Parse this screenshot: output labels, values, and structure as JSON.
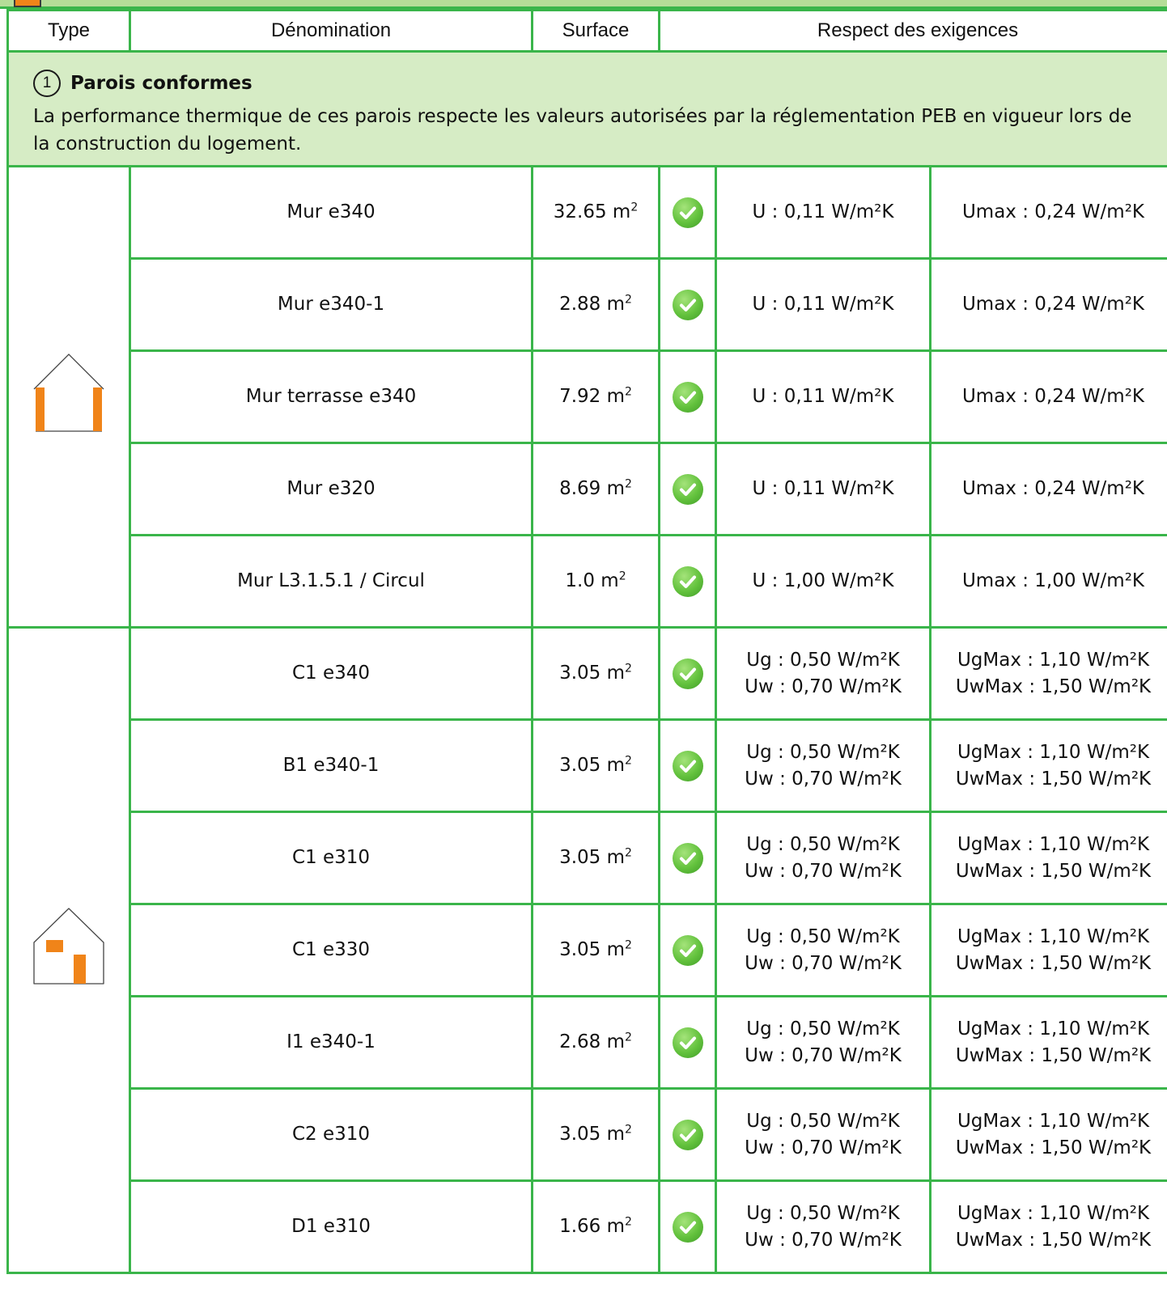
{
  "header": {
    "col_type": "Type",
    "col_name": "Dénomination",
    "col_surface": "Surface",
    "col_respect": "Respect des exigences"
  },
  "section": {
    "number": "1",
    "title": "Parois conformes",
    "description": "La performance thermique de ces parois respecte les valeurs autorisées par la réglementation PEB en vigueur lors de la construction du logement."
  },
  "colors": {
    "border": "#3ab54a",
    "section_bg": "#d6ecc5",
    "accent": "#f08419",
    "check": "#63c23d"
  },
  "icons": {
    "walls": "house-walls-icon",
    "windows": "house-windows-icon",
    "status": "checkmark-icon"
  },
  "unit_sup": "2",
  "walls": [
    {
      "name": "Mur e340",
      "surface": "32.65 m",
      "u": "U : 0,11 W/m²K",
      "umax": "Umax : 0,24 W/m²K"
    },
    {
      "name": "Mur e340-1",
      "surface": "2.88 m",
      "u": "U : 0,11 W/m²K",
      "umax": "Umax : 0,24 W/m²K"
    },
    {
      "name": "Mur terrasse e340",
      "surface": "7.92 m",
      "u": "U : 0,11 W/m²K",
      "umax": "Umax : 0,24 W/m²K"
    },
    {
      "name": "Mur e320",
      "surface": "8.69 m",
      "u": "U : 0,11 W/m²K",
      "umax": "Umax : 0,24 W/m²K"
    },
    {
      "name": "Mur L3.1.5.1 / Circul",
      "surface": "1.0 m",
      "u": "U : 1,00 W/m²K",
      "umax": "Umax : 1,00 W/m²K"
    }
  ],
  "windows": [
    {
      "name": "C1 e340",
      "surface": "3.05 m",
      "ug": "Ug : 0,50 W/m²K",
      "uw": "Uw : 0,70 W/m²K",
      "ugmax": "UgMax : 1,10 W/m²K",
      "uwmax": "UwMax : 1,50 W/m²K"
    },
    {
      "name": "B1 e340-1",
      "surface": "3.05 m",
      "ug": "Ug : 0,50 W/m²K",
      "uw": "Uw : 0,70 W/m²K",
      "ugmax": "UgMax : 1,10 W/m²K",
      "uwmax": "UwMax : 1,50 W/m²K"
    },
    {
      "name": "C1 e310",
      "surface": "3.05 m",
      "ug": "Ug : 0,50 W/m²K",
      "uw": "Uw : 0,70 W/m²K",
      "ugmax": "UgMax : 1,10 W/m²K",
      "uwmax": "UwMax : 1,50 W/m²K"
    },
    {
      "name": "C1 e330",
      "surface": "3.05 m",
      "ug": "Ug : 0,50 W/m²K",
      "uw": "Uw : 0,70 W/m²K",
      "ugmax": "UgMax : 1,10 W/m²K",
      "uwmax": "UwMax : 1,50 W/m²K"
    },
    {
      "name": "I1 e340-1",
      "surface": "2.68 m",
      "ug": "Ug : 0,50 W/m²K",
      "uw": "Uw : 0,70 W/m²K",
      "ugmax": "UgMax : 1,10 W/m²K",
      "uwmax": "UwMax : 1,50 W/m²K"
    },
    {
      "name": "C2 e310",
      "surface": "3.05 m",
      "ug": "Ug : 0,50 W/m²K",
      "uw": "Uw : 0,70 W/m²K",
      "ugmax": "UgMax : 1,10 W/m²K",
      "uwmax": "UwMax : 1,50 W/m²K"
    },
    {
      "name": "D1 e310",
      "surface": "1.66 m",
      "ug": "Ug : 0,50 W/m²K",
      "uw": "Uw : 0,70 W/m²K",
      "ugmax": "UgMax : 1,10 W/m²K",
      "uwmax": "UwMax : 1,50 W/m²K"
    }
  ]
}
